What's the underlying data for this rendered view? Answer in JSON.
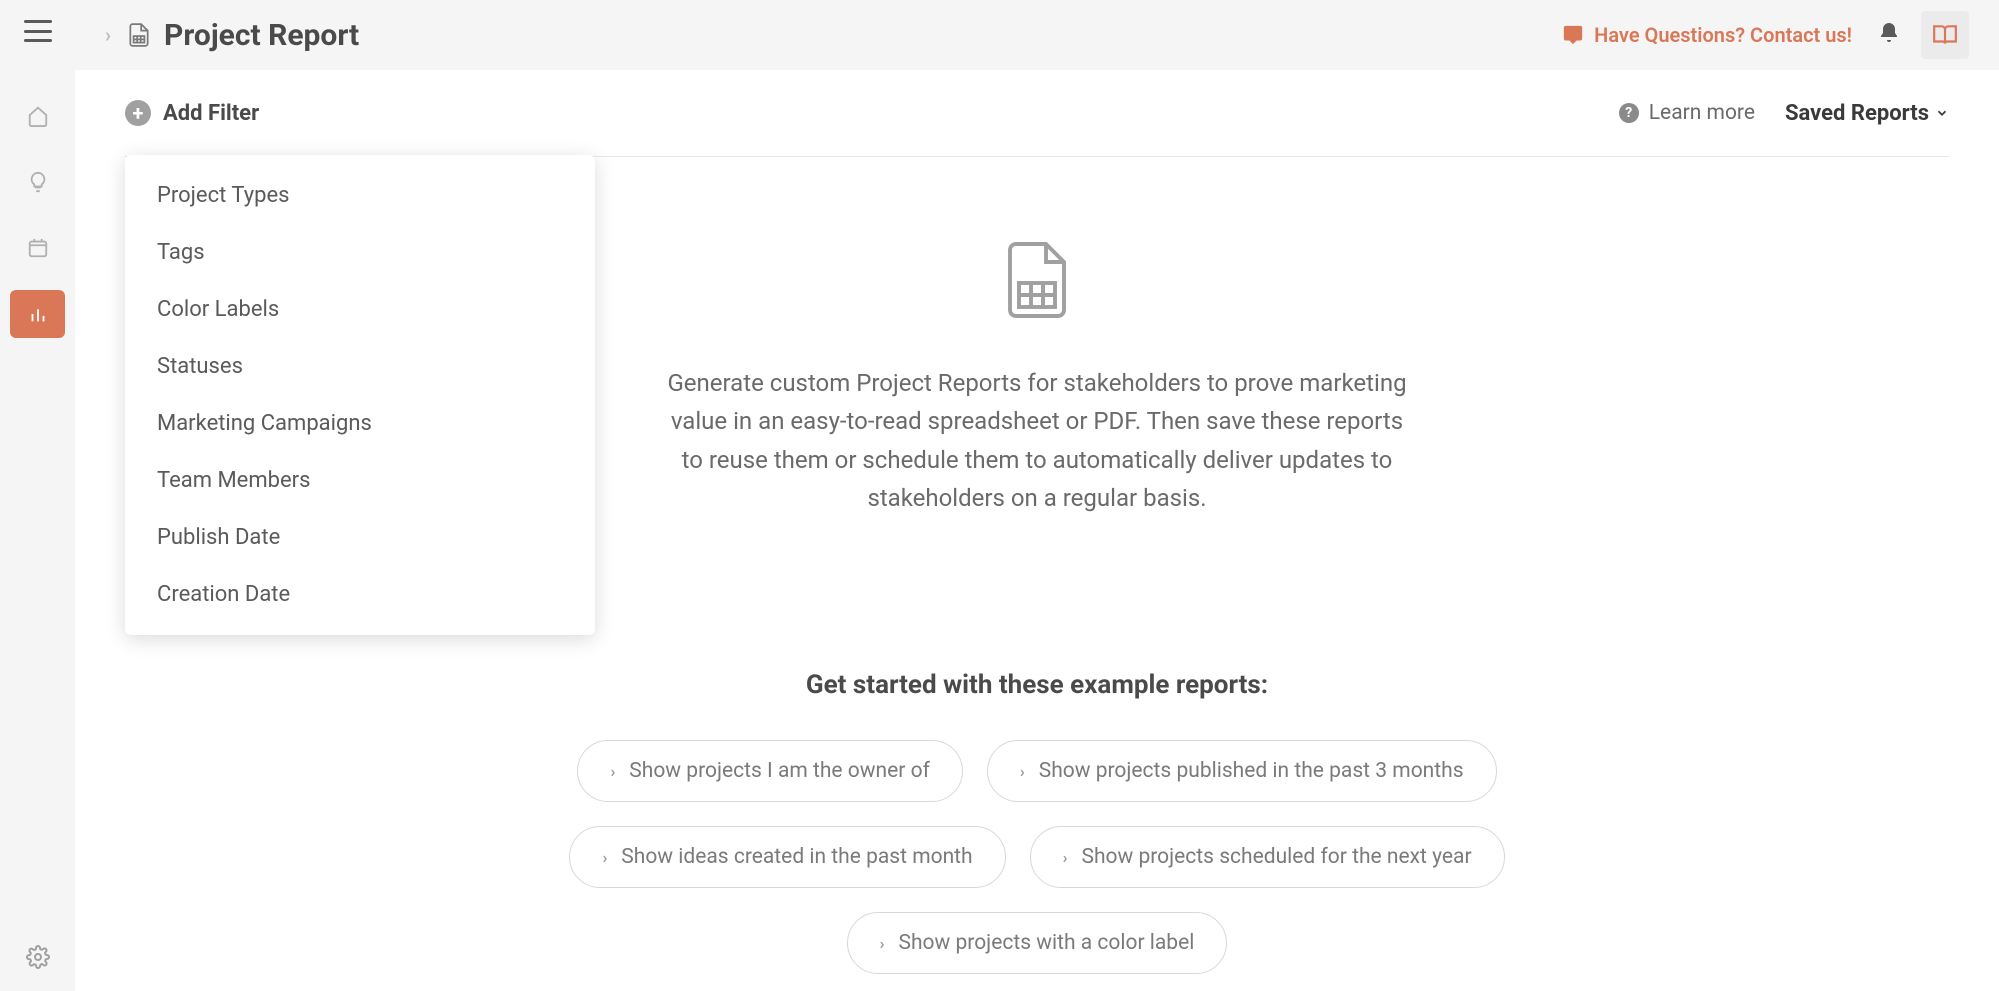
{
  "header": {
    "page_title": "Project Report",
    "contact_link": "Have Questions? Contact us!"
  },
  "content_header": {
    "add_filter_label": "Add Filter",
    "learn_more_label": "Learn more",
    "saved_reports_label": "Saved Reports"
  },
  "filter_dropdown": {
    "items": [
      "Project Types",
      "Tags",
      "Color Labels",
      "Statuses",
      "Marketing Campaigns",
      "Team Members",
      "Publish Date",
      "Creation Date"
    ]
  },
  "empty_state": {
    "description": "Generate custom Project Reports for stakeholders to prove marketing value in an easy-to-read spreadsheet or PDF. Then save these reports to reuse them or schedule them to automatically deliver updates to stakeholders on a regular basis."
  },
  "examples": {
    "heading": "Get started with these example reports:",
    "buttons": [
      "Show projects I am the owner of",
      "Show projects published in the past 3 months",
      "Show ideas created in the past month",
      "Show projects scheduled for the next year",
      "Show projects with a color label"
    ]
  },
  "colors": {
    "accent": "#d97757"
  }
}
